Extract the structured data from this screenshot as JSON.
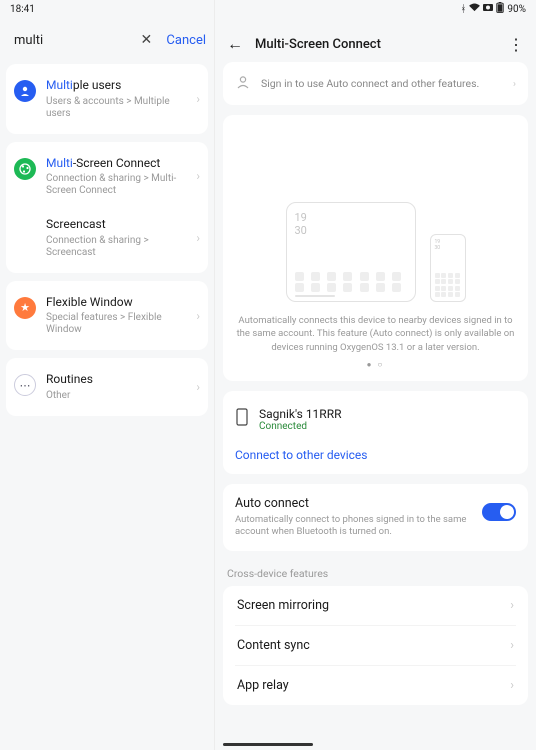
{
  "status": {
    "time": "18:41",
    "battery": "90%"
  },
  "search": {
    "query": "multi",
    "cancel": "Cancel"
  },
  "results": [
    {
      "hl": "Multi",
      "rest": "ple users",
      "path": "Users & accounts > Multiple users",
      "icon": "person",
      "bg": "#265df1"
    },
    {
      "hl": "Multi",
      "rest": "-Screen Connect",
      "path": "Connection & sharing > Multi-Screen Connect",
      "icon": "share",
      "bg": "#1db955"
    },
    {
      "hl": "",
      "rest": "Screencast",
      "path": "Connection & sharing > Screencast",
      "icon": "",
      "bg": ""
    },
    {
      "hl": "",
      "rest": "Flexible Window",
      "path": "Special features > Flexible Window",
      "icon": "star",
      "bg": "#ff7a3d"
    },
    {
      "hl": "",
      "rest": "Routines",
      "path": "Other",
      "icon": "dots",
      "bg": "#fff"
    }
  ],
  "page": {
    "title": "Multi-Screen Connect",
    "signin": "Sign in to use Auto connect and other features.",
    "promoClock": "19\n30",
    "promoText": "Automatically connects this device to nearby devices signed in to the same account. This feature (Auto connect) is only available on devices running OxygenOS 13.1 or a later version.",
    "device": {
      "name": "Sagnik's 11RRR",
      "status": "Connected"
    },
    "link": "Connect to other devices",
    "auto": {
      "title": "Auto connect",
      "desc": "Automatically connect to phones signed in to the same account when Bluetooth is turned on."
    },
    "featHdr": "Cross-device features",
    "features": [
      "Screen mirroring",
      "Content sync",
      "App relay"
    ]
  }
}
